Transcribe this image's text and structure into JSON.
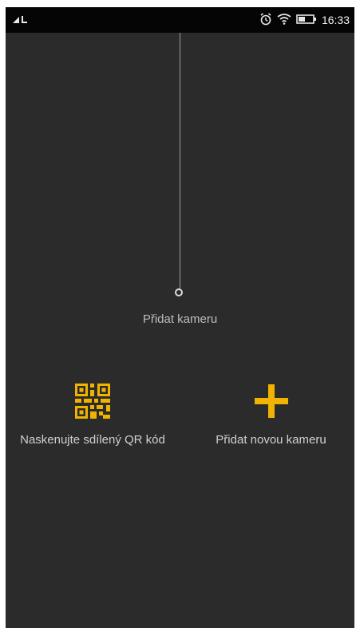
{
  "status_bar": {
    "time": "16:33",
    "icons": [
      "signal-icon",
      "alarm-icon",
      "wifi-icon",
      "battery-icon"
    ]
  },
  "main": {
    "hint_label": "Přidat kameru",
    "actions": [
      {
        "icon": "qr-code-icon",
        "label": "Naskenujte sdílený QR kód"
      },
      {
        "icon": "plus-icon",
        "label": "Přidat novou kameru"
      }
    ]
  },
  "colors": {
    "background": "#2b2b2b",
    "status_bar": "#050505",
    "accent": "#f0b400"
  }
}
